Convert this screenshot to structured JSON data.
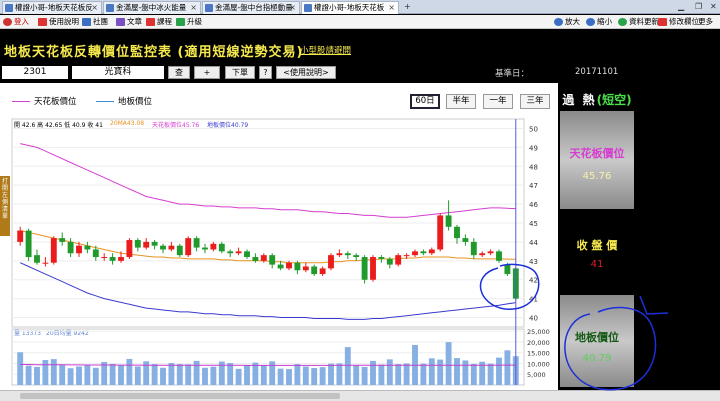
{
  "tabs": [
    {
      "label": "權證小哥-地板天花板反",
      "active": false
    },
    {
      "label": "金滿屋-盤中冰火能量",
      "active": false
    },
    {
      "label": "金滿屋-盤中台指極動量",
      "active": false
    },
    {
      "label": "權證小哥-地板天花板",
      "active": true
    }
  ],
  "toolbar": {
    "left": [
      "登入",
      "使用說明",
      "社團",
      "文章",
      "課程",
      "升級"
    ],
    "right": [
      "放大",
      "縮小",
      "資料更新",
      "修改欄位",
      "更多"
    ],
    "badge": "JK"
  },
  "title": {
    "main": "地板天花板反轉價位監控表 (適用短線逆勢交易)",
    "sub": "小型股請避開"
  },
  "stock": {
    "code": "2301",
    "name": "光寶科"
  },
  "buttons": {
    "query": "查",
    "add": "+",
    "next": "下單",
    "help_q": "?",
    "help": "<使用說明>"
  },
  "base_date": {
    "label": "基準日：",
    "value": "20171101"
  },
  "legend": {
    "ceiling": "天花板價位",
    "floor": "地板價位"
  },
  "periods": [
    {
      "label": "60日",
      "selected": true
    },
    {
      "label": "半年",
      "selected": false
    },
    {
      "label": "一年",
      "selected": false
    },
    {
      "label": "三年",
      "selected": false
    }
  ],
  "side_label": "打開左側清單",
  "info": {
    "ohlc": "開 42.6  高 42.65  低 40.9  收 41",
    "ma": "20MA43.08",
    "ceiling": "天花板價位45.76",
    "floor": "地板價位40.79"
  },
  "vol_info": {
    "vol": "量 13373",
    "ma": "20日均量 9242"
  },
  "right_panel": {
    "status_word": "過  熱",
    "status_tag": "(短空)",
    "ceiling_label": "天花板價位",
    "ceiling_value": "45.76",
    "close_label": "收 盤 價",
    "close_value": "41",
    "floor_label": "地板價位",
    "floor_value": "40.79"
  },
  "colors": {
    "up": "#ea1c1c",
    "down": "#1f9a2b",
    "ceiling": "#d63dd0",
    "floor": "#3a3ad0",
    "ma": "#e6931f",
    "title": "#f5e94e"
  },
  "chart_data": {
    "type": "line",
    "price_axis": {
      "ylim": [
        39.5,
        50.5
      ],
      "ticks": [
        40,
        41,
        42,
        43,
        44,
        45,
        46,
        47,
        48,
        49,
        50
      ]
    },
    "volume_axis": {
      "ylim": [
        0,
        26000
      ],
      "ticks": [
        5000,
        10000,
        15000,
        20000,
        25000
      ]
    },
    "ceiling": [
      49.2,
      49.1,
      49.0,
      48.8,
      48.6,
      48.4,
      48.2,
      48.0,
      47.8,
      47.6,
      47.4,
      47.2,
      47.0,
      46.8,
      46.6,
      46.4,
      46.3,
      46.2,
      46.1,
      46.0,
      46.0,
      45.95,
      45.9,
      45.9,
      45.85,
      45.85,
      45.8,
      45.8,
      45.8,
      45.75,
      45.75,
      45.7,
      45.7,
      45.7,
      45.65,
      45.6,
      45.6,
      45.55,
      45.5,
      45.5,
      45.45,
      45.4,
      45.4,
      45.35,
      45.3,
      45.3,
      45.3,
      45.35,
      45.4,
      45.45,
      45.5,
      45.55,
      45.6,
      45.65,
      45.7,
      45.75,
      45.8,
      45.8,
      45.78,
      45.76
    ],
    "floor": [
      42.9,
      42.7,
      42.5,
      42.3,
      42.1,
      41.9,
      41.7,
      41.5,
      41.3,
      41.15,
      41.0,
      40.9,
      40.8,
      40.7,
      40.6,
      40.5,
      40.45,
      40.4,
      40.35,
      40.3,
      40.3,
      40.25,
      40.2,
      40.2,
      40.15,
      40.15,
      40.1,
      40.1,
      40.1,
      40.05,
      40.05,
      40.0,
      40.0,
      40.0,
      40.0,
      39.95,
      39.95,
      39.95,
      39.95,
      39.9,
      39.9,
      39.9,
      39.95,
      39.95,
      40.0,
      40.05,
      40.1,
      40.15,
      40.2,
      40.25,
      40.3,
      40.35,
      40.4,
      40.45,
      40.5,
      40.55,
      40.6,
      40.65,
      40.72,
      40.79
    ],
    "ma20": [
      44.6,
      44.5,
      44.4,
      44.3,
      44.2,
      44.1,
      44.0,
      43.9,
      43.8,
      43.7,
      43.6,
      43.5,
      43.4,
      43.35,
      43.3,
      43.25,
      43.2,
      43.2,
      43.15,
      43.15,
      43.1,
      43.1,
      43.1,
      43.1,
      43.05,
      43.05,
      43.0,
      43.0,
      43.0,
      43.0,
      42.95,
      42.95,
      42.9,
      42.9,
      42.9,
      42.9,
      42.9,
      42.95,
      42.95,
      43.0,
      43.0,
      43.05,
      43.05,
      43.1,
      43.1,
      43.1,
      43.15,
      43.15,
      43.2,
      43.2,
      43.2,
      43.2,
      43.15,
      43.15,
      43.1,
      43.1,
      43.1,
      43.1,
      43.09,
      43.08
    ],
    "candles": [
      [
        44.0,
        44.6,
        44.8,
        43.8
      ],
      [
        44.6,
        43.2,
        44.7,
        43.0
      ],
      [
        43.3,
        42.9,
        43.6,
        42.8
      ],
      [
        42.9,
        42.9,
        43.2,
        42.7
      ],
      [
        42.9,
        44.2,
        44.3,
        42.8
      ],
      [
        44.2,
        44.0,
        44.5,
        43.8
      ],
      [
        44.0,
        43.4,
        44.2,
        43.2
      ],
      [
        43.4,
        43.8,
        44.0,
        43.2
      ],
      [
        43.8,
        43.6,
        44.0,
        43.4
      ],
      [
        43.6,
        43.2,
        43.8,
        43.0
      ],
      [
        43.2,
        43.2,
        43.4,
        43.0
      ],
      [
        43.2,
        43.0,
        43.4,
        42.8
      ],
      [
        43.0,
        43.2,
        43.5,
        42.9
      ],
      [
        43.2,
        44.1,
        44.2,
        43.1
      ],
      [
        44.1,
        43.7,
        44.2,
        43.5
      ],
      [
        43.7,
        44.0,
        44.2,
        43.6
      ],
      [
        44.0,
        43.8,
        44.1,
        43.6
      ],
      [
        43.8,
        43.6,
        43.9,
        43.4
      ],
      [
        43.6,
        43.8,
        44.0,
        43.5
      ],
      [
        43.8,
        43.3,
        43.9,
        43.2
      ],
      [
        43.3,
        44.2,
        44.3,
        43.2
      ],
      [
        44.2,
        43.7,
        44.3,
        43.5
      ],
      [
        43.7,
        43.6,
        43.9,
        43.4
      ],
      [
        43.6,
        43.9,
        44.0,
        43.5
      ],
      [
        43.9,
        43.5,
        44.0,
        43.4
      ],
      [
        43.5,
        43.4,
        43.6,
        43.2
      ],
      [
        43.4,
        43.5,
        43.7,
        43.3
      ],
      [
        43.5,
        43.2,
        43.6,
        43.1
      ],
      [
        43.2,
        43.0,
        43.4,
        42.9
      ],
      [
        43.0,
        43.3,
        43.4,
        42.9
      ],
      [
        43.3,
        42.8,
        43.4,
        42.6
      ],
      [
        42.8,
        42.6,
        43.0,
        42.5
      ],
      [
        42.6,
        42.9,
        43.0,
        42.5
      ],
      [
        42.9,
        42.5,
        43.0,
        42.3
      ],
      [
        42.5,
        42.7,
        42.9,
        42.4
      ],
      [
        42.7,
        42.3,
        42.8,
        42.2
      ],
      [
        42.3,
        42.6,
        42.7,
        42.2
      ],
      [
        42.6,
        43.3,
        43.4,
        42.5
      ],
      [
        43.3,
        43.4,
        43.6,
        43.2
      ],
      [
        43.4,
        43.3,
        43.5,
        43.1
      ],
      [
        43.3,
        43.2,
        43.4,
        43.0
      ],
      [
        43.2,
        42.0,
        43.3,
        41.8
      ],
      [
        42.0,
        43.2,
        43.3,
        41.9
      ],
      [
        43.2,
        43.1,
        43.3,
        42.9
      ],
      [
        43.1,
        42.8,
        43.2,
        42.6
      ],
      [
        42.8,
        43.3,
        43.4,
        42.7
      ],
      [
        43.3,
        43.3,
        43.4,
        43.1
      ],
      [
        43.3,
        43.5,
        43.6,
        43.2
      ],
      [
        43.5,
        43.4,
        43.6,
        43.3
      ],
      [
        43.4,
        43.6,
        43.7,
        43.3
      ],
      [
        43.6,
        45.4,
        45.5,
        43.5
      ],
      [
        45.4,
        44.8,
        46.2,
        44.6
      ],
      [
        44.8,
        44.2,
        44.9,
        43.9
      ],
      [
        44.2,
        44.0,
        44.4,
        43.8
      ],
      [
        44.0,
        43.3,
        44.2,
        43.1
      ],
      [
        43.3,
        43.4,
        43.5,
        43.2
      ],
      [
        43.4,
        43.5,
        43.6,
        43.3
      ],
      [
        43.5,
        43.0,
        43.6,
        42.9
      ],
      [
        42.8,
        42.3,
        42.9,
        42.2
      ],
      [
        42.6,
        41.0,
        42.65,
        40.9
      ]
    ],
    "volume": [
      15200,
      9000,
      8400,
      11600,
      12000,
      9500,
      7800,
      8600,
      9300,
      8000,
      10700,
      9800,
      9200,
      12100,
      8600,
      11000,
      9700,
      8000,
      10200,
      9700,
      9600,
      11200,
      8000,
      8500,
      10900,
      10200,
      7500,
      9100,
      10400,
      9200,
      11000,
      7600,
      7400,
      9700,
      8600,
      7900,
      8300,
      9900,
      10000,
      17600,
      9100,
      8400,
      11200,
      9500,
      11900,
      9700,
      10000,
      18600,
      9900,
      12400,
      11800,
      19900,
      12500,
      11400,
      9800,
      10800,
      9900,
      12700,
      16100,
      13373
    ],
    "volume_ma20": [
      9500,
      9500,
      9400,
      9400,
      9400,
      9400,
      9350,
      9350,
      9300,
      9300,
      9300,
      9300,
      9250,
      9250,
      9250,
      9200,
      9200,
      9200,
      9200,
      9200,
      9200,
      9200,
      9200,
      9150,
      9150,
      9150,
      9150,
      9100,
      9100,
      9100,
      9100,
      9100,
      9100,
      9100,
      9100,
      9100,
      9100,
      9100,
      9150,
      9150,
      9150,
      9150,
      9150,
      9150,
      9150,
      9200,
      9200,
      9200,
      9200,
      9200,
      9200,
      9200,
      9200,
      9200,
      9200,
      9200,
      9200,
      9220,
      9230,
      9242
    ]
  }
}
